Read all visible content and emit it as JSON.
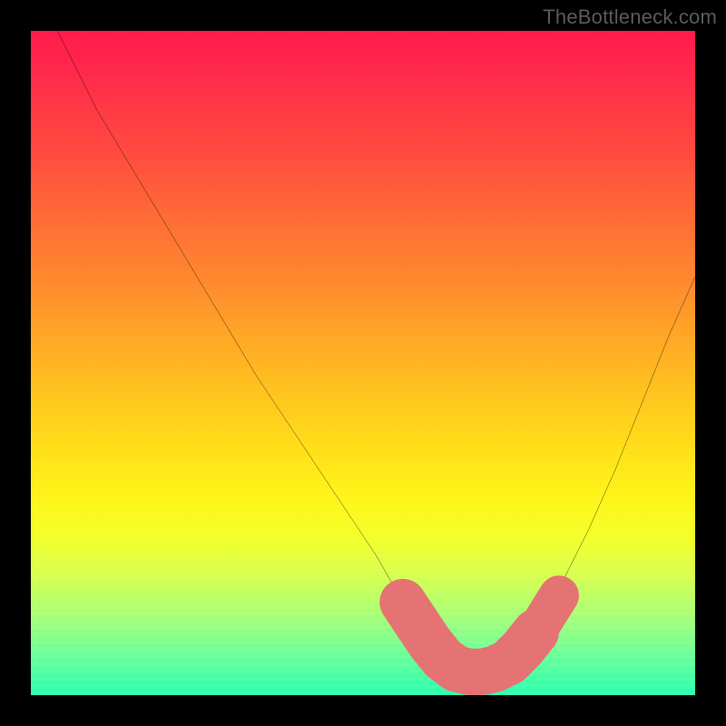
{
  "watermark": {
    "text": "TheBottleneck.com"
  },
  "colors": {
    "curve": "#000000",
    "highlight": "#e57373",
    "frame_bg": "#000000"
  },
  "chart_data": {
    "type": "line",
    "title": "",
    "xlabel": "",
    "ylabel": "",
    "xlim": [
      0,
      100
    ],
    "ylim": [
      0,
      100
    ],
    "series": [
      {
        "name": "bottleneck-curve",
        "x": [
          0,
          5,
          10,
          15,
          20,
          25,
          30,
          35,
          40,
          45,
          50,
          55,
          60,
          63,
          66,
          70,
          72,
          75,
          80,
          85,
          90,
          95,
          100
        ],
        "values": [
          100,
          90,
          81,
          72,
          64,
          56,
          48,
          40,
          33,
          26,
          19,
          13,
          7,
          4,
          3,
          3,
          4,
          7,
          15,
          26,
          38,
          51,
          65
        ]
      }
    ],
    "highlight_segment": {
      "note": "thick salmon segment near the minimum",
      "x": [
        55,
        58,
        60,
        62,
        64,
        66,
        68,
        70,
        72,
        74,
        76
      ],
      "values": [
        11,
        8,
        6,
        4,
        3,
        3,
        3,
        3,
        4,
        5,
        7
      ]
    },
    "annotations": []
  }
}
